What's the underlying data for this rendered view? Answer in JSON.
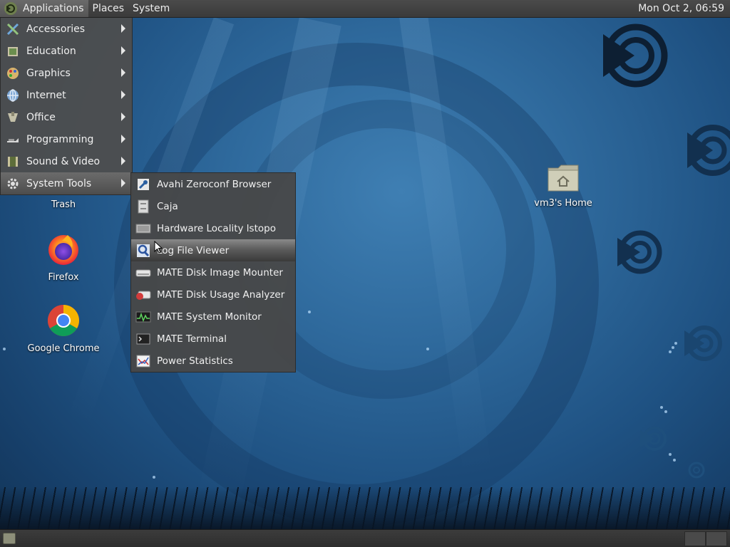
{
  "top_panel": {
    "menus": [
      "Applications",
      "Places",
      "System"
    ],
    "clock": "Mon Oct  2, 06:59"
  },
  "applications_menu": {
    "items": [
      {
        "label": "Accessories",
        "icon": "accessories-icon"
      },
      {
        "label": "Education",
        "icon": "education-icon"
      },
      {
        "label": "Graphics",
        "icon": "graphics-icon"
      },
      {
        "label": "Internet",
        "icon": "internet-icon"
      },
      {
        "label": "Office",
        "icon": "office-icon"
      },
      {
        "label": "Programming",
        "icon": "programming-icon"
      },
      {
        "label": "Sound & Video",
        "icon": "sound-video-icon"
      },
      {
        "label": "System Tools",
        "icon": "system-tools-icon",
        "active": true
      }
    ]
  },
  "system_tools_menu": {
    "items": [
      {
        "label": "Avahi Zeroconf Browser",
        "icon": "avahi-icon"
      },
      {
        "label": "Caja",
        "icon": "file-cabinet-icon"
      },
      {
        "label": "Hardware Locality lstopo",
        "icon": "hardware-icon"
      },
      {
        "label": "Log File Viewer",
        "icon": "log-viewer-icon",
        "hover": true
      },
      {
        "label": "MATE Disk Image Mounter",
        "icon": "disk-mounter-icon"
      },
      {
        "label": "MATE Disk Usage Analyzer",
        "icon": "disk-usage-icon"
      },
      {
        "label": "MATE System Monitor",
        "icon": "system-monitor-icon"
      },
      {
        "label": "MATE Terminal",
        "icon": "terminal-icon"
      },
      {
        "label": "Power Statistics",
        "icon": "power-stats-icon"
      }
    ]
  },
  "desktop": {
    "trash_label": "Trash",
    "firefox_label": "Firefox",
    "chrome_label": "Google Chrome",
    "home_label": "vm3's Home"
  },
  "colors": {
    "panel": "#3a3a3a",
    "menu_bg": "#4e4e4e",
    "wallpaper": "#2f6a9d"
  }
}
